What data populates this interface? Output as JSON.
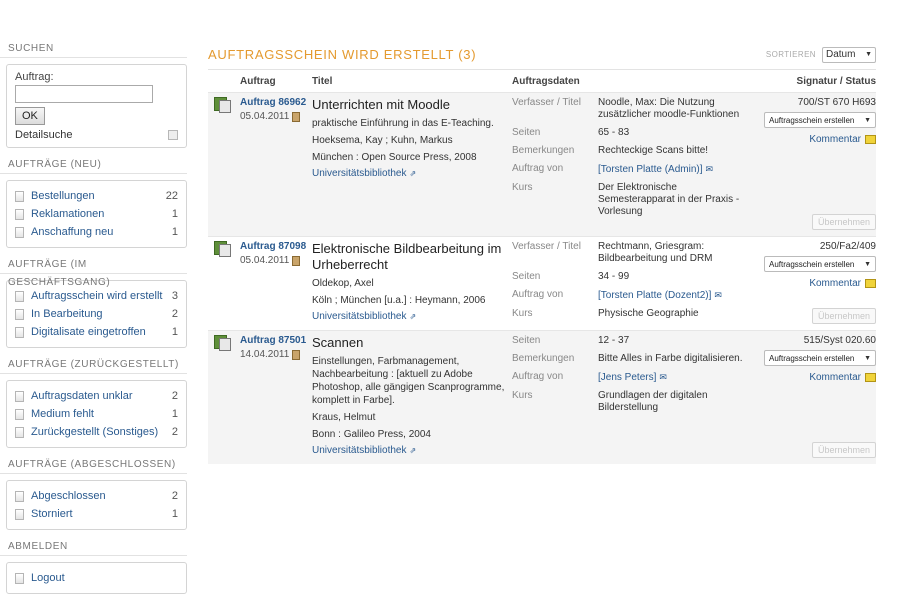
{
  "sidebar": {
    "search": {
      "header": "SUCHEN",
      "label": "Auftrag:",
      "input_value": "",
      "ok_label": "OK",
      "detail_label": "Detailsuche"
    },
    "groups": [
      {
        "header": "AUFTRÄGE (NEU)",
        "items": [
          {
            "label": "Bestellungen",
            "count": "22"
          },
          {
            "label": "Reklamationen",
            "count": "1"
          },
          {
            "label": "Anschaffung neu",
            "count": "1"
          }
        ]
      },
      {
        "header": "AUFTRÄGE (IM GESCHÄFTSGANG)",
        "items": [
          {
            "label": "Auftragsschein wird erstellt",
            "count": "3"
          },
          {
            "label": "In Bearbeitung",
            "count": "2"
          },
          {
            "label": "Digitalisate eingetroffen",
            "count": "1"
          }
        ]
      },
      {
        "header": "AUFTRÄGE (ZURÜCKGESTELLT)",
        "items": [
          {
            "label": "Auftragsdaten unklar",
            "count": "2"
          },
          {
            "label": "Medium fehlt",
            "count": "1"
          },
          {
            "label": "Zurückgestellt (Sonstiges)",
            "count": "2"
          }
        ]
      },
      {
        "header": "AUFTRÄGE (ABGESCHLOSSEN)",
        "items": [
          {
            "label": "Abgeschlossen",
            "count": "2"
          },
          {
            "label": "Storniert",
            "count": "1"
          }
        ]
      },
      {
        "header": "ABMELDEN",
        "items": [
          {
            "label": "Logout",
            "count": ""
          }
        ]
      }
    ]
  },
  "main": {
    "title": "AUFTRAGSSCHEIN WIRD ERSTELLT (3)",
    "sort_label": "SORTIEREN",
    "sort_value": "Datum",
    "columns": {
      "auftrag": "Auftrag",
      "titel": "Titel",
      "daten": "Auftragsdaten",
      "status": "Signatur / Status"
    },
    "orders": [
      {
        "id": "Auftrag 86962",
        "date": "05.04.2011",
        "title": "Unterrichten mit Moodle",
        "lines": [
          "praktische Einführung in das E-Teaching.",
          "Hoeksema, Kay ; Kuhn, Markus",
          "München : Open Source Press, 2008"
        ],
        "library": "Universitätsbibliothek",
        "data": [
          {
            "k": "Verfasser / Titel",
            "v": "Noodle, Max: Die Nutzung zusätzlicher moodle-Funktionen",
            "link": false
          },
          {
            "k": "Seiten",
            "v": "65 - 83",
            "link": false
          },
          {
            "k": "Bemerkungen",
            "v": "Rechteckige Scans bitte!",
            "link": false
          },
          {
            "k": "Auftrag von",
            "v": "[Torsten Platte (Admin)]",
            "link": true
          },
          {
            "k": "Kurs",
            "v": "Der Elektronische Semesterapparat in der Praxis - Vorlesung",
            "link": false
          }
        ],
        "signature": "700/ST 670 H693",
        "status": "Auftragsschein erstellen",
        "comment": "Kommentar",
        "take": "Übernehmen"
      },
      {
        "id": "Auftrag 87098",
        "date": "05.04.2011",
        "title": "Elektronische Bildbearbeitung im Urheberrecht",
        "lines": [
          "Oldekop, Axel",
          "Köln ; München [u.a.] : Heymann, 2006"
        ],
        "library": "Universitätsbibliothek",
        "data": [
          {
            "k": "Verfasser / Titel",
            "v": "Rechtmann, Griesgram: Bildbearbeitung und DRM",
            "link": false
          },
          {
            "k": "Seiten",
            "v": "34 - 99",
            "link": false
          },
          {
            "k": "Auftrag von",
            "v": "[Torsten Platte (Dozent2)]",
            "link": true
          },
          {
            "k": "Kurs",
            "v": "Physische Geographie",
            "link": false
          }
        ],
        "signature": "250/Fa2/409",
        "status": "Auftragsschein erstellen",
        "comment": "Kommentar",
        "take": "Übernehmen"
      },
      {
        "id": "Auftrag 87501",
        "date": "14.04.2011",
        "title": "Scannen",
        "lines": [
          "Einstellungen, Farbmanagement, Nachbearbeitung : [aktuell zu Adobe Photoshop, alle gängigen Scanprogramme, komplett in Farbe].",
          "Kraus, Helmut",
          "Bonn : Galileo Press, 2004"
        ],
        "library": "Universitätsbibliothek",
        "data": [
          {
            "k": "Seiten",
            "v": "12 - 37",
            "link": false
          },
          {
            "k": "Bemerkungen",
            "v": "Bitte Alles in Farbe digitalisieren.",
            "link": false
          },
          {
            "k": "Auftrag von",
            "v": "[Jens Peters]",
            "link": true
          },
          {
            "k": "Kurs",
            "v": "Grundlagen der digitalen Bilderstellung",
            "link": false
          }
        ],
        "signature": "515/Syst 020.60",
        "status": "Auftragsschein erstellen",
        "comment": "Kommentar",
        "take": "Übernehmen"
      }
    ]
  }
}
